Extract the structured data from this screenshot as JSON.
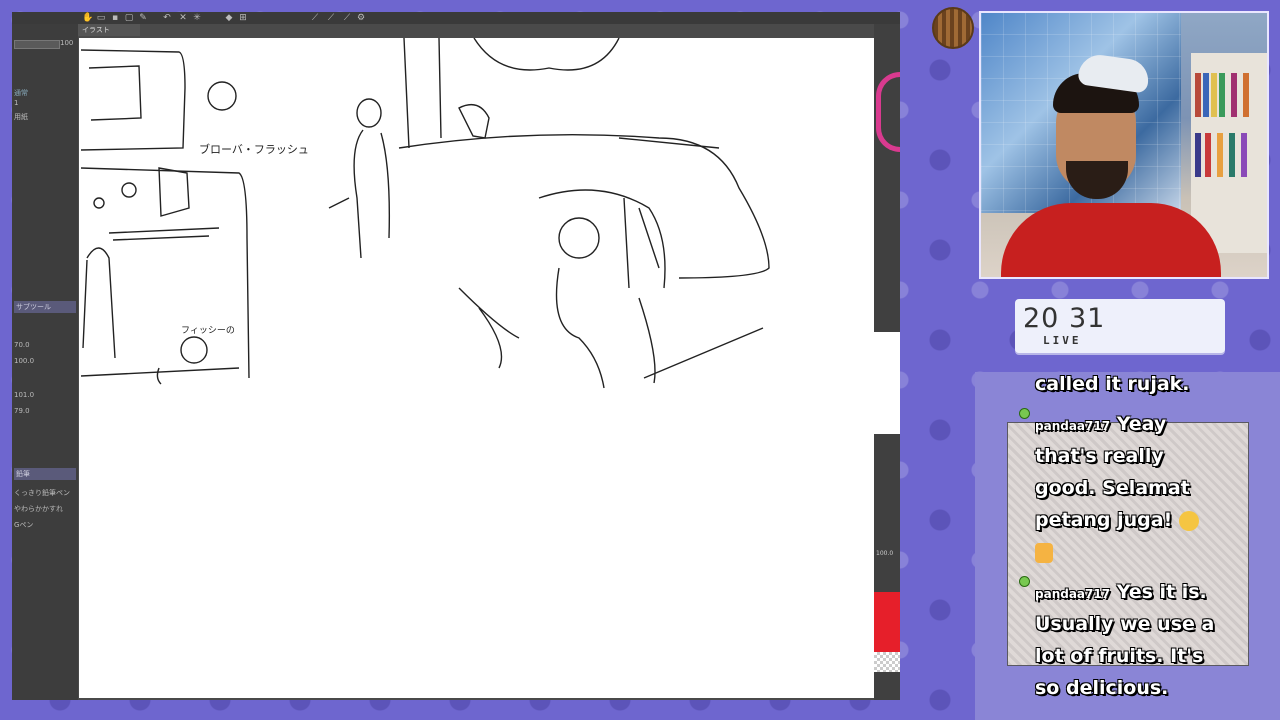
{
  "colors": {
    "background": "#6e66cf",
    "app_dark": "#3d3d3d",
    "canvas": "#ffffff",
    "shirt": "#c7201f",
    "timer_bg": "#eef0fb",
    "chat_text": "#ffffff",
    "badge": "#78c850"
  },
  "app": {
    "canvas_tab": "イラスト",
    "left_panel": {
      "zoom_value": "100",
      "items": [
        "通常",
        "1",
        "用紙"
      ],
      "brush_tab": "サブツール",
      "brush_sizes": [
        "70.0",
        "100.0",
        "101.0",
        "79.0"
      ],
      "pen_tab": "鉛筆",
      "pen_items": [
        "くっきり鉛筆ペン",
        "やわらかかすれ",
        "Gペン"
      ]
    },
    "right_strip": {
      "zoom_label": "100.0"
    }
  },
  "sketch": {
    "label_a": "ブローバ・フラッシュ",
    "label_b": "フィッシーの"
  },
  "timer": {
    "time": "20 31",
    "label": "LIVE"
  },
  "chat": {
    "messages": [
      {
        "user": "",
        "text_lines": [
          "called it rujak."
        ]
      },
      {
        "user": "pandaa717",
        "text_lines": [
          "Yeay",
          "that's really",
          "good. Selamat",
          "petang juga!"
        ]
      },
      {
        "user": "pandaa717",
        "text_lines": [
          "Yes it is.",
          "Usually we use a",
          "lot of fruits. It's",
          "so delicious."
        ]
      }
    ],
    "emoji_icons": [
      "grinning-face-icon",
      "thumbs-up-icon"
    ]
  }
}
